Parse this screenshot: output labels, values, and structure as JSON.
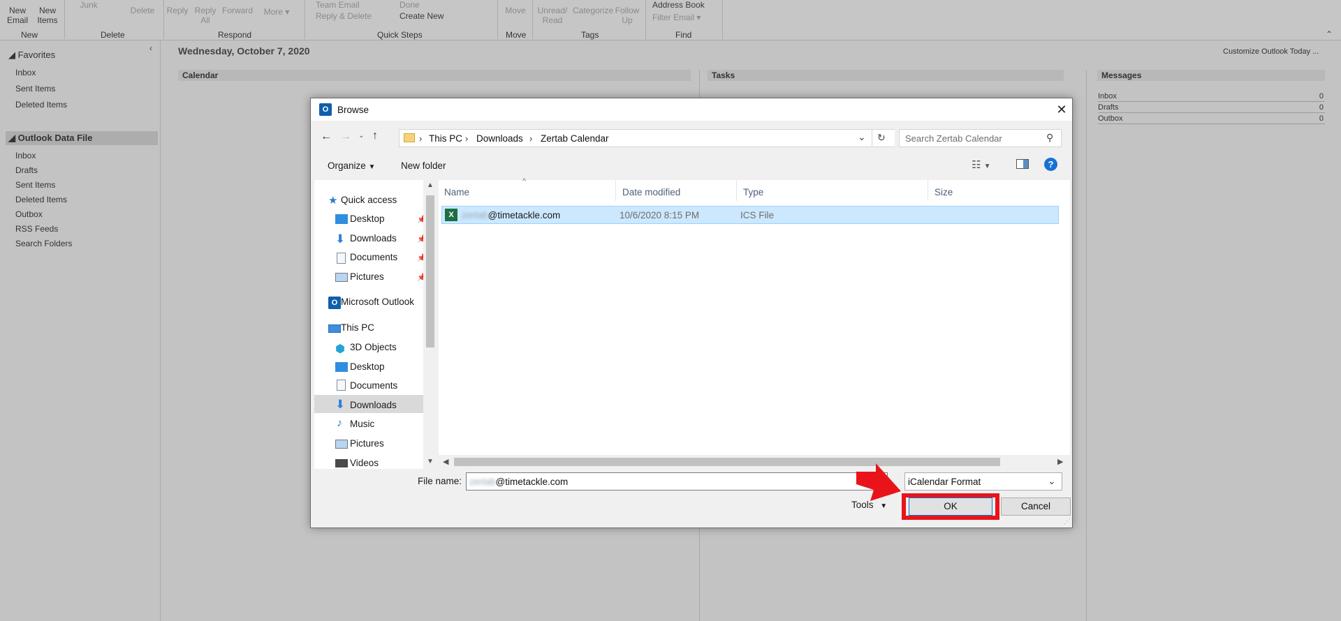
{
  "ribbon": {
    "new_email": "New\nEmail",
    "new_items": "New\nItems",
    "junk": "Junk",
    "delete": "Delete",
    "reply": "Reply",
    "reply_all": "Reply\nAll",
    "forward": "Forward",
    "more": "More",
    "qs_team_email": "Team Email",
    "qs_done": "Done",
    "qs_reply_delete": "Reply & Delete",
    "qs_create_new": "Create New",
    "move": "Move",
    "unread_read": "Unread/\nRead",
    "categorize": "Categorize",
    "follow_up": "Follow\nUp",
    "address_book": "Address Book",
    "filter_email": "Filter Email",
    "groups": {
      "new": "New",
      "delete": "Delete",
      "respond": "Respond",
      "quick_steps": "Quick Steps",
      "move": "Move",
      "tags": "Tags",
      "find": "Find"
    }
  },
  "nav": {
    "favorites_header": "Favorites",
    "favorites": [
      "Inbox",
      "Sent Items",
      "Deleted Items"
    ],
    "data_file_header": "Outlook Data File",
    "data_file": [
      "Inbox",
      "Drafts",
      "Sent Items",
      "Deleted Items",
      "Outbox",
      "RSS Feeds",
      "Search Folders"
    ]
  },
  "today": {
    "date": "Wednesday, October 7, 2020",
    "customize": "Customize Outlook Today ...",
    "calendar_header": "Calendar",
    "tasks_header": "Tasks",
    "messages_header": "Messages",
    "messages": [
      {
        "name": "Inbox",
        "count": "0"
      },
      {
        "name": "Drafts",
        "count": "0"
      },
      {
        "name": "Outbox",
        "count": "0"
      }
    ]
  },
  "dialog": {
    "title": "Browse",
    "breadcrumb": [
      "This PC",
      "Downloads",
      "Zertab Calendar"
    ],
    "search_placeholder": "Search Zertab Calendar",
    "organize": "Organize",
    "new_folder": "New folder",
    "tree": {
      "quick_access": "Quick access",
      "qa_items": [
        "Desktop",
        "Downloads",
        "Documents",
        "Pictures"
      ],
      "microsoft_outlook": "Microsoft Outlook",
      "this_pc": "This PC",
      "pc_items": [
        "3D Objects",
        "Desktop",
        "Documents",
        "Downloads",
        "Music",
        "Pictures",
        "Videos"
      ]
    },
    "columns": [
      "Name",
      "Date modified",
      "Type",
      "Size"
    ],
    "files": [
      {
        "name_blur": "zertab",
        "name": "@timetackle.com",
        "date": "10/6/2020 8:15 PM",
        "type": "ICS File",
        "size": ""
      }
    ],
    "file_name_label": "File name:",
    "file_name_blur": "zertab",
    "file_name_value": "@timetackle.com",
    "file_type": "iCalendar Format",
    "tools": "Tools",
    "ok": "OK",
    "cancel": "Cancel"
  },
  "colors": {
    "highlight": "#e8141a",
    "selection": "#cce8ff",
    "accent": "#0f5fad"
  }
}
